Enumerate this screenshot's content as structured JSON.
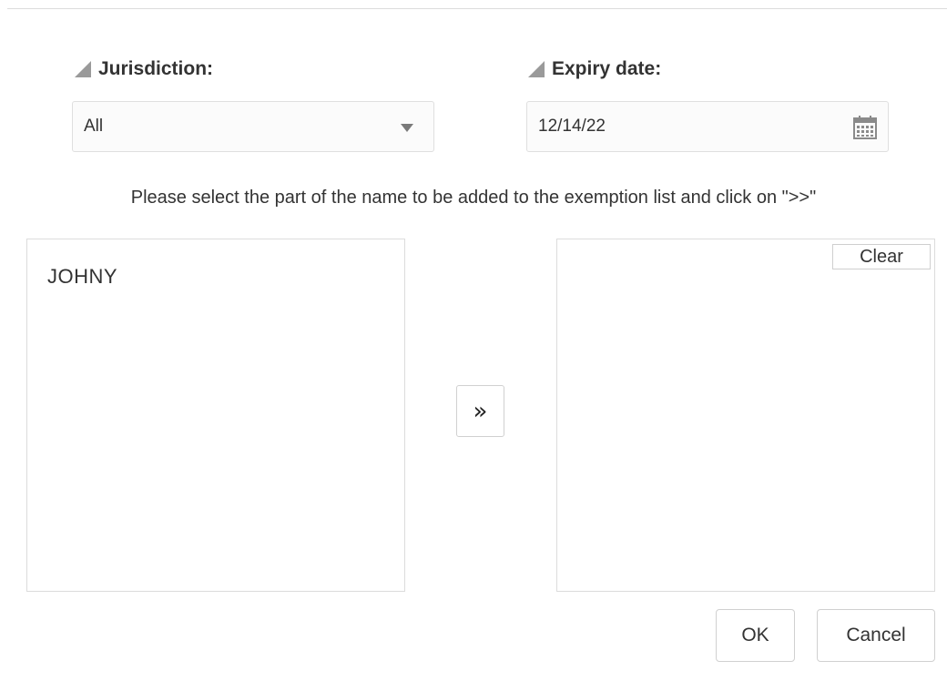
{
  "jurisdiction": {
    "label": "Jurisdiction:",
    "selected_value": "All"
  },
  "expiry": {
    "label": "Expiry date:",
    "value": "12/14/22"
  },
  "instruction_text": "Please select the part of the name to be added to the exemption list and click on \">>\"",
  "source_list": {
    "name": "JOHNY"
  },
  "exemption_list": {
    "clear_label": "Clear",
    "items": []
  },
  "move_button_label": "»",
  "actions": {
    "ok_label": "OK",
    "cancel_label": "Cancel"
  },
  "colors": {
    "label_triangle": "#9a9a9a",
    "border": "#dcdcdc",
    "input_background": "#fbfbfb",
    "text": "#333333"
  },
  "icons": {
    "label_marker": "triangle-marker-icon",
    "select_arrow": "dropdown-arrow-icon",
    "calendar": "calendar-icon",
    "move_right": "double-chevron-right-icon"
  }
}
